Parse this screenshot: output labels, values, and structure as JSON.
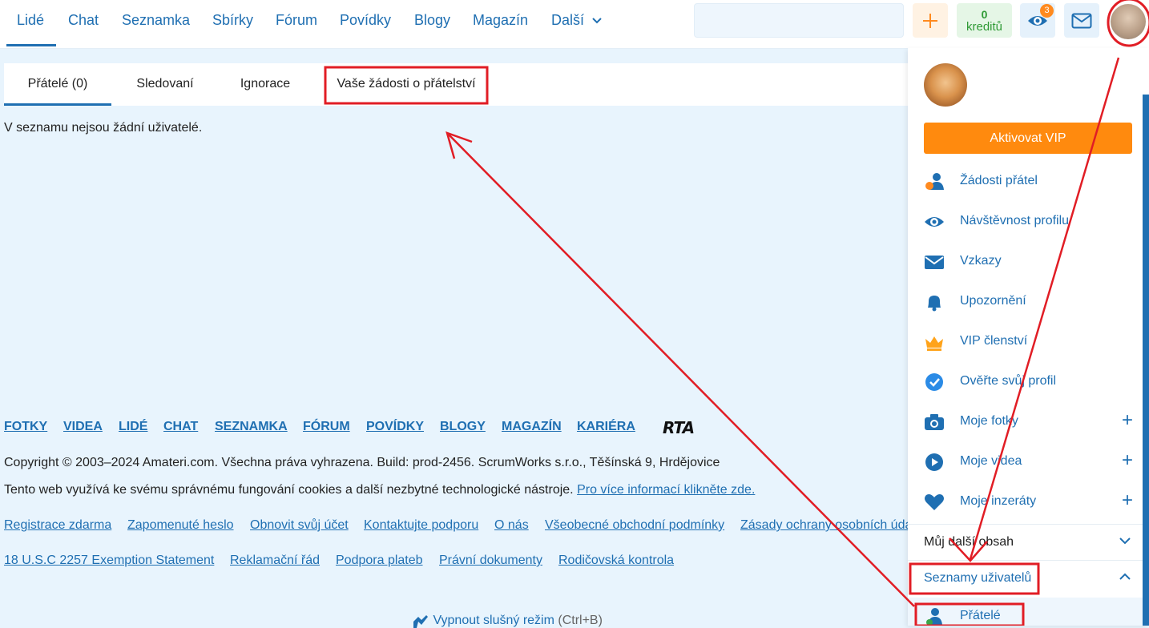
{
  "nav": {
    "items": [
      "Lidé",
      "Chat",
      "Seznamka",
      "Sbírky",
      "Fórum",
      "Povídky",
      "Blogy",
      "Magazín",
      "Další"
    ],
    "credits_num": "0",
    "credits_label": "kreditů",
    "eye_badge": "3"
  },
  "tabs": [
    "Přátelé (0)",
    "Sledovaní",
    "Ignorace",
    "Vaše žádosti o přátelství"
  ],
  "main": {
    "empty_message": "V seznamu nejsou žádní uživatelé."
  },
  "footer": {
    "main_links": [
      "FOTKY",
      "VIDEA",
      "LIDÉ",
      "CHAT",
      "SEZNAMKA",
      "FÓRUM",
      "POVÍDKY",
      "BLOGY",
      "MAGAZÍN",
      "KARIÉRA"
    ],
    "rta": "RTA",
    "copyright": "Copyright © 2003–2024 Amateri.com. Všechna práva vyhrazena. Build: prod-2456. ScrumWorks s.r.o., Těšínská 9, Hrdějovice",
    "cookies_text": "Tento web využívá ke svému správnému fungování cookies a další nezbytné technologické nástroje. ",
    "cookies_link": "Pro více informací klikněte zde.",
    "row3": [
      "Registrace zdarma",
      "Zapomenuté heslo",
      "Obnovit svůj účet",
      "Kontaktujte podporu",
      "O nás",
      "Všeobecné obchodní podmínky",
      "Zásady ochrany osobních údajů"
    ],
    "row4": [
      "18 U.S.C 2257 Exemption Statement",
      "Reklamační řád",
      "Podpora plateb",
      "Právní dokumenty",
      "Rodičovská kontrola"
    ],
    "safe_mode": "Vypnout slušný režim",
    "safe_mode_hint": "(Ctrl+B)"
  },
  "panel": {
    "vip_button": "Aktivovat VIP",
    "items": [
      "Žádosti přátel",
      "Návštěvnost profilu",
      "Vzkazy",
      "Upozornění",
      "VIP členství",
      "Ověřte svůj profil",
      "Moje fotky",
      "Moje videa",
      "Moje inzeráty"
    ],
    "section_more": "Můj další obsah",
    "section_lists": "Seznamy uživatelů",
    "sub_friends": "Přátelé"
  },
  "colors": {
    "accent": "#1f6fb2",
    "vip": "#ff8a0e",
    "annotation": "#e11d25"
  }
}
